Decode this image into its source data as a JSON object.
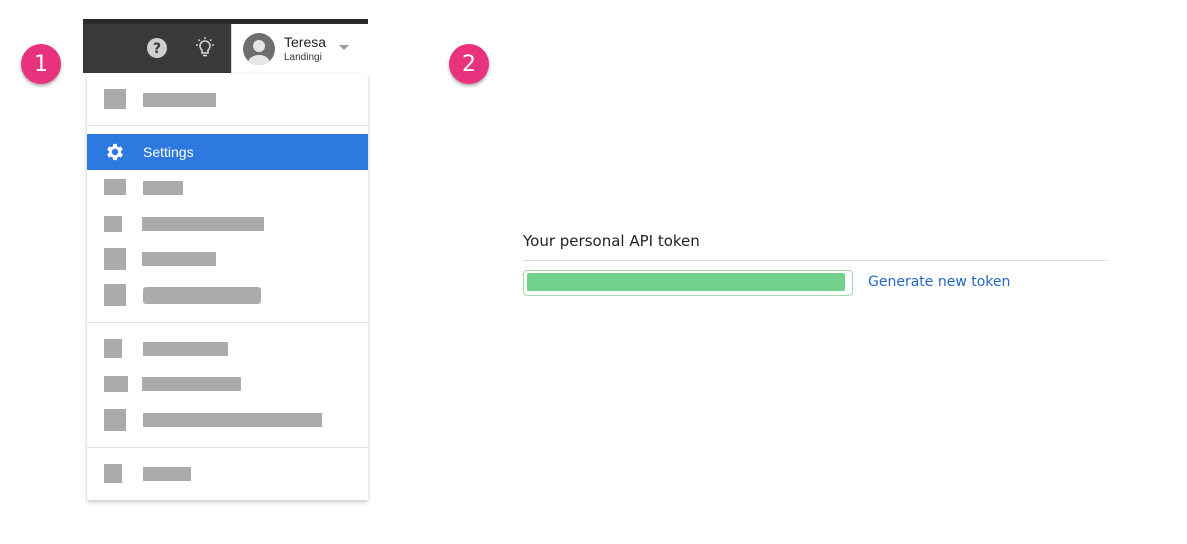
{
  "steps": {
    "first": "1",
    "second": "2"
  },
  "header": {
    "user": {
      "name": "Teresa",
      "company": "Landingi"
    },
    "icons": {
      "help": "help-circle-icon",
      "idea": "lightbulb-icon",
      "avatar": "user-avatar-icon",
      "caret": "chevron-down-icon"
    }
  },
  "menu": {
    "active_item": {
      "label": "Settings",
      "icon": "gear-icon"
    },
    "placeholder_items": 9
  },
  "api": {
    "title": "Your personal API token",
    "token_value": "",
    "generate_label": "Generate new token"
  },
  "colors": {
    "badge": "#e8327e",
    "active_menu": "#2d79e0",
    "token_fill": "#72d18c",
    "link": "#2566c7"
  }
}
